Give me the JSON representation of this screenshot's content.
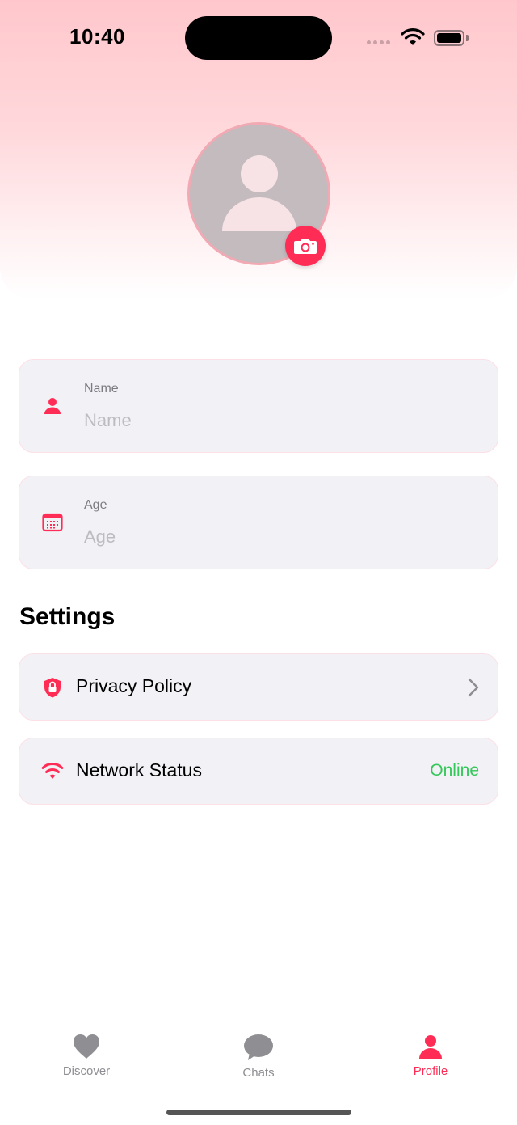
{
  "status_bar": {
    "time": "10:40",
    "icons": [
      "signal-dots-icon",
      "wifi-icon",
      "battery-icon"
    ]
  },
  "profile": {
    "avatar_icon": "person-placeholder-icon",
    "camera_button_icon": "camera-icon"
  },
  "fields": [
    {
      "label": "Name",
      "placeholder": "Name",
      "value": "",
      "icon": "person-icon"
    },
    {
      "label": "Age",
      "placeholder": "Age",
      "value": "",
      "icon": "calendar-icon"
    }
  ],
  "settings": {
    "title": "Settings",
    "items": [
      {
        "label": "Privacy Policy",
        "icon": "shield-lock-icon",
        "accessory": "chevron-right-icon"
      },
      {
        "label": "Network Status",
        "icon": "wifi-icon",
        "status": "Online"
      }
    ]
  },
  "colors": {
    "accent": "#ff2d55",
    "status_online": "#34c759",
    "inactive_tab": "#8e8e93",
    "card_bg": "#f2f1f6"
  },
  "tab_bar": {
    "items": [
      {
        "label": "Discover",
        "icon": "heart-icon",
        "active": false
      },
      {
        "label": "Chats",
        "icon": "chat-bubble-icon",
        "active": false
      },
      {
        "label": "Profile",
        "icon": "person-icon",
        "active": true
      }
    ]
  }
}
